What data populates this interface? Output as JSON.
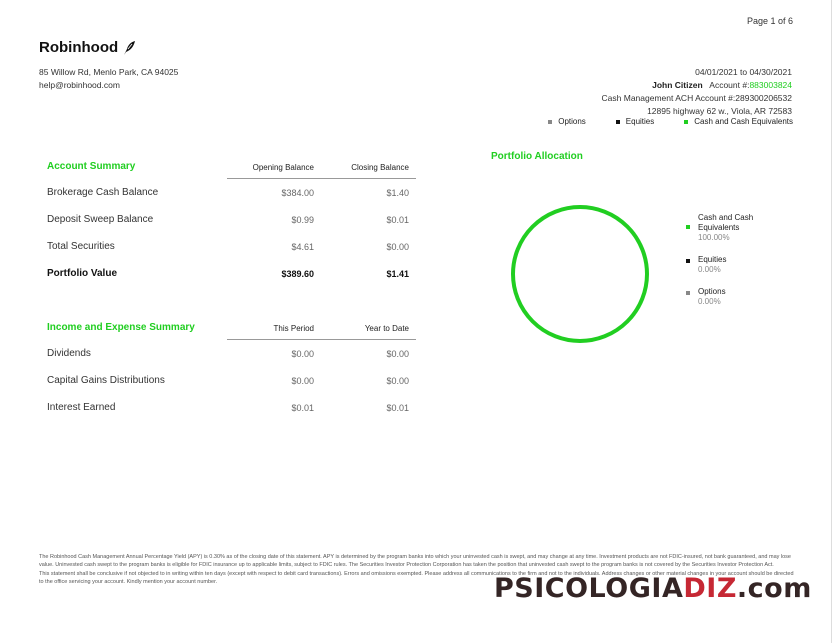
{
  "page": {
    "label": "Page 1 of 6"
  },
  "brand": {
    "name": "Robinhood",
    "address_line1": "85 Willow Rd, Menlo Park, CA 94025",
    "email": "help@robinhood.com"
  },
  "account": {
    "period": "04/01/2021 to 04/30/2021",
    "holder_name": "John Citizen",
    "account_label": "Account #:",
    "account_number": "883003824",
    "cash_mgmt": "Cash Management ACH Account #:289300206532",
    "street": "12895 highway 62 w., Viola, AR 72583"
  },
  "legend_top": [
    {
      "label": "Options",
      "color": "#888888"
    },
    {
      "label": "Equities",
      "color": "#111111"
    },
    {
      "label": "Cash and Cash Equivalents",
      "color": "#21ce21"
    }
  ],
  "account_summary": {
    "title": "Account Summary",
    "col1": "Opening Balance",
    "col2": "Closing Balance",
    "rows": [
      {
        "label": "Brokerage Cash Balance",
        "v1": "$384.00",
        "v2": "$1.40"
      },
      {
        "label": "Deposit Sweep Balance",
        "v1": "$0.99",
        "v2": "$0.01"
      },
      {
        "label": "Total Securities",
        "v1": "$4.61",
        "v2": "$0.00"
      },
      {
        "label": "Portfolio Value",
        "v1": "$389.60",
        "v2": "$1.41"
      }
    ]
  },
  "income_summary": {
    "title": "Income and Expense Summary",
    "col1": "This Period",
    "col2": "Year to Date",
    "rows": [
      {
        "label": "Dividends",
        "v1": "$0.00",
        "v2": "$0.00"
      },
      {
        "label": "Capital Gains Distributions",
        "v1": "$0.00",
        "v2": "$0.00"
      },
      {
        "label": "Interest Earned",
        "v1": "$0.01",
        "v2": "$0.01"
      }
    ]
  },
  "allocation": {
    "title": "Portfolio Allocation",
    "items": [
      {
        "label": "Cash and Cash Equivalents",
        "pct": "100.00%",
        "color": "#21ce21"
      },
      {
        "label": "Equities",
        "pct": "0.00%",
        "color": "#111111"
      },
      {
        "label": "Options",
        "pct": "0.00%",
        "color": "#888888"
      }
    ]
  },
  "disclaimer": {
    "p1": "The Robinhood Cash Management Annual Percentage Yield (APY) is 0.30% as of the closing date of this statement. APY is determined by the program banks into which your uninvested cash is swept, and may change at any time. Investment products are not FDIC-insured, not bank guaranteed, and may lose value. Uninvested cash swept to the program banks is eligible for FDIC insurance up to applicable limits, subject to FDIC rules. The Securities Investor Protection Corporation has taken the position that uninvested cash swept to the program banks is not covered by the Securities Investor Protection Act.",
    "p2": "This statement shall be conclusive if not objected to in writing within ten days (except with respect to debit card transactions). Errors and omissions exempted. Please address all communications to the firm and not to the individuals. Address changes or other material changes in your account should be directed to the office servicing your account. Kindly mention your account number."
  },
  "watermark": {
    "part1": "PSICOLOGIA",
    "part2": "DIZ",
    "part3": ".com"
  }
}
